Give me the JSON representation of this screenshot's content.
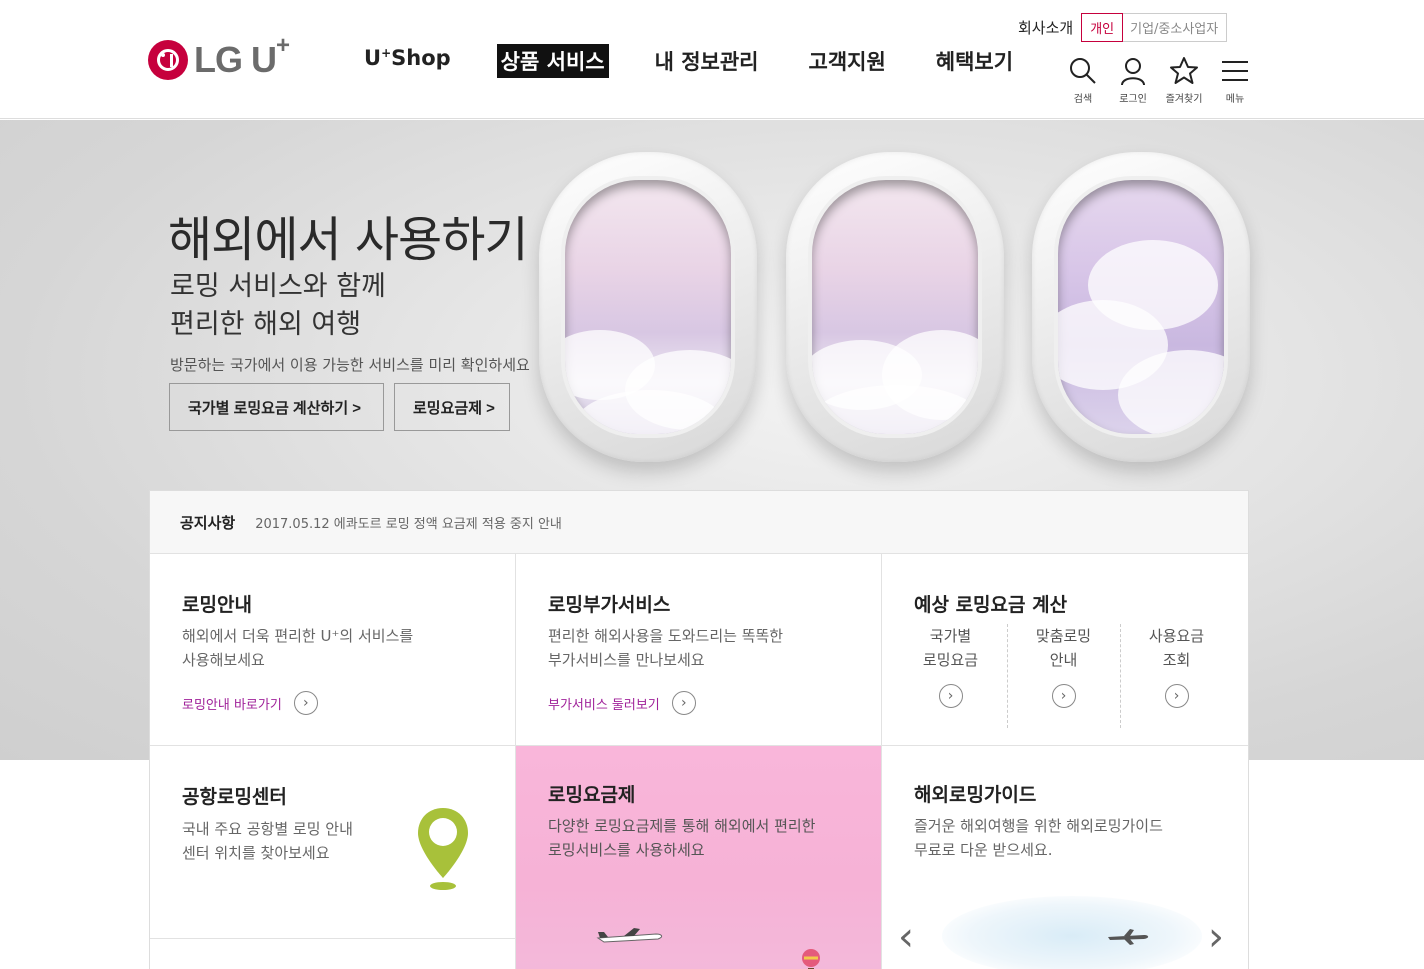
{
  "header": {
    "logo_text": "LG U",
    "logo_sup": "+",
    "top_links": {
      "company": "회사소개",
      "segments": [
        "개인",
        "기업/중소사업자"
      ]
    },
    "gnb": [
      {
        "label": "U",
        "sup": "+",
        "rest": "Shop"
      },
      {
        "label": "상품 서비스"
      },
      {
        "label": "내 정보관리"
      },
      {
        "label": "고객지원"
      },
      {
        "label": "혜택보기"
      }
    ],
    "utils": [
      {
        "icon": "search-icon",
        "label": "검색"
      },
      {
        "icon": "user-icon",
        "label": "로그인"
      },
      {
        "icon": "star-icon",
        "label": "즐겨찾기"
      },
      {
        "icon": "menu-icon",
        "label": "메뉴"
      }
    ]
  },
  "hero": {
    "title": "해외에서 사용하기",
    "subtitle_line1": "로밍 서비스와 함께",
    "subtitle_line2": "편리한 해외 여행",
    "desc": "방문하는 국가에서 이용 가능한 서비스를 미리 확인하세요",
    "btn_calc": "국가별 로밍요금 계산하기 >",
    "btn_plan": "로밍요금제 >"
  },
  "notice": {
    "title": "공지사항",
    "text": "2017.05.12 에콰도르 로밍 정액 요금제 적용 중지 안내"
  },
  "cards": {
    "roaming_guide": {
      "title": "로밍안내",
      "desc1": "해외에서 더욱 편리한 U⁺의 서비스를",
      "desc2": "사용해보세요",
      "link": "로밍안내 바로가기"
    },
    "addon": {
      "title": "로밍부가서비스",
      "desc1": "편리한 해외사용을 도와드리는 똑똑한",
      "desc2": "부가서비스를 만나보세요",
      "link": "부가서비스 둘러보기"
    },
    "calc": {
      "title": "예상 로밍요금 계산",
      "cols": [
        {
          "l1": "국가별",
          "l2": "로밍요금"
        },
        {
          "l1": "맞춤로밍",
          "l2": "안내"
        },
        {
          "l1": "사용요금",
          "l2": "조회"
        }
      ]
    },
    "airport": {
      "title": "공항로밍센터",
      "desc1": "국내 주요 공항별 로밍 안내",
      "desc2": "센터 위치를 찾아보세요"
    },
    "plan": {
      "title": "로밍요금제",
      "desc1": "다양한 로밍요금제를 통해 해외에서 편리한",
      "desc2": "로밍서비스를 사용하세요"
    },
    "overseas_guide": {
      "title": "해외로밍가이드",
      "desc1": "즐거운 해외여행을 위한 해외로밍가이드",
      "desc2": "무료로 다운 받으세요."
    }
  },
  "colors": {
    "brand": "#c6003d",
    "link": "#a0229a",
    "pink_card": "#f7b3d8",
    "pin": "#a8c13a"
  }
}
